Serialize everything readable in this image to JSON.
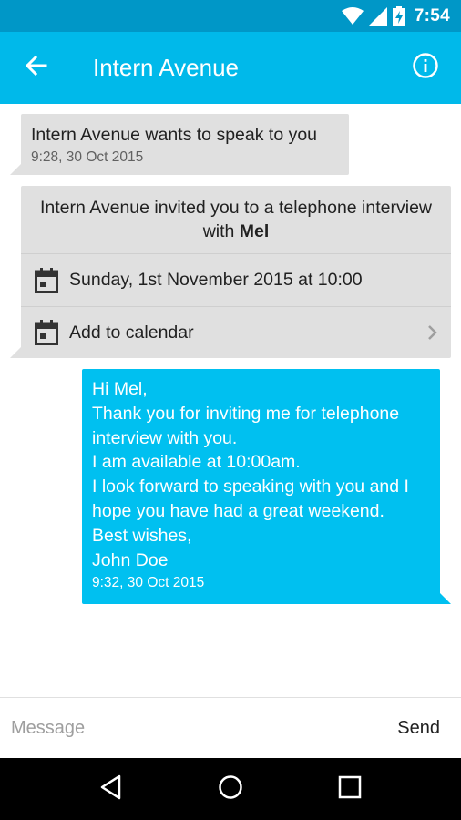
{
  "status_bar": {
    "time": "7:54",
    "icons": [
      "wifi-icon",
      "cellular-signal-icon",
      "battery-charging-icon"
    ]
  },
  "app_bar": {
    "title": "Intern Avenue",
    "back_icon": "arrow-back-icon",
    "info_icon": "info-icon"
  },
  "messages": {
    "incoming_1": {
      "text": "Intern Avenue wants to speak to you",
      "time": "9:28, 30 Oct 2015"
    },
    "invite": {
      "text": "Intern Avenue invited you to a telephone interview with",
      "name": "Mel",
      "date_text": "Sunday, 1st November 2015 at 10:00",
      "calendar_action": "Add to calendar"
    },
    "outgoing_1": {
      "lines": [
        "Hi Mel,",
        "Thank you for inviting me for telephone interview with you.",
        "I am available at 10:00am.",
        "I look forward to speaking with you and I hope you have had a great weekend.",
        "Best wishes,",
        "John Doe"
      ],
      "time": "9:32, 30 Oct 2015"
    }
  },
  "composer": {
    "placeholder": "Message",
    "send_label": "Send"
  },
  "nav_bar": {
    "icons": [
      "back-triangle-icon",
      "home-circle-icon",
      "recents-square-icon"
    ]
  },
  "colors": {
    "status_bar": "#0097c7",
    "app_bar": "#00b9ea",
    "outgoing_bubble": "#00c0f0",
    "incoming_bubble": "#e0e0e0"
  }
}
